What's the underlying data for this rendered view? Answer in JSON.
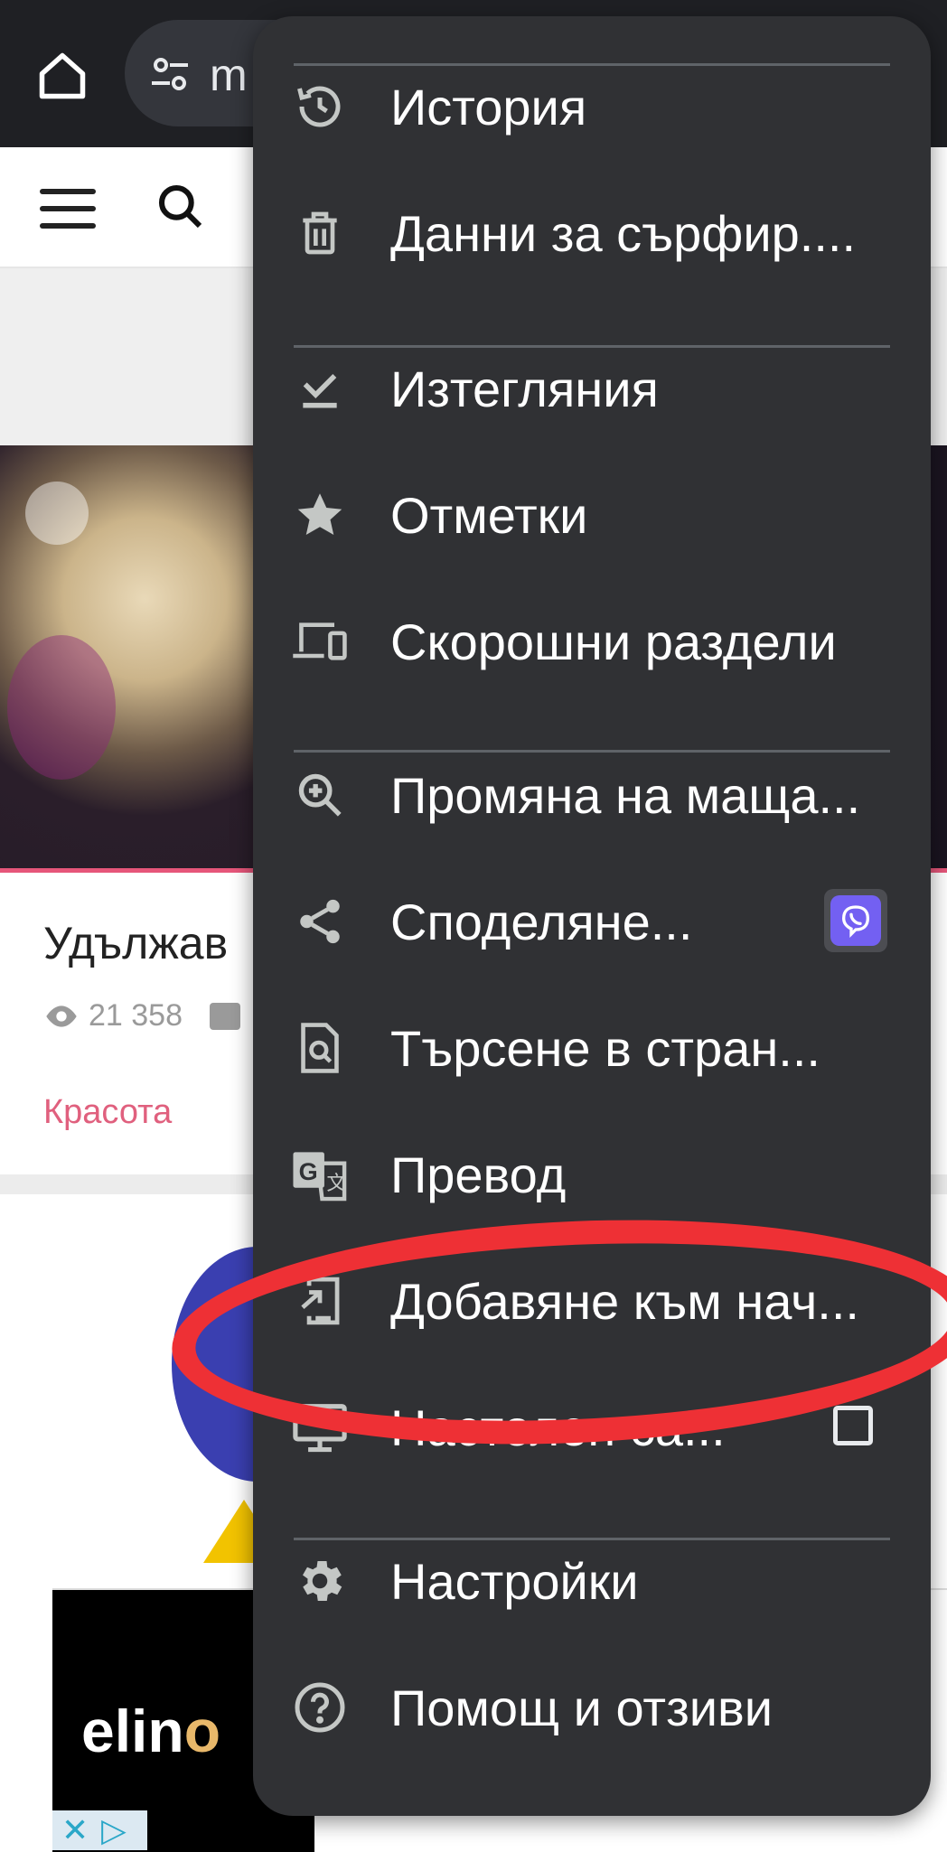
{
  "toolbar": {
    "url_partial": "m"
  },
  "page": {
    "article_title_partial": "Удължав",
    "views": "21 358",
    "category": "Красота",
    "ad_logo_partial": "elin",
    "ad_logo_letter": "o"
  },
  "menu": {
    "items": [
      {
        "label": "История",
        "icon": "history-icon"
      },
      {
        "label": "Данни за сърфир....",
        "icon": "delete-icon"
      },
      {
        "label": "Изтегляния",
        "icon": "download-done-icon"
      },
      {
        "label": "Отметки",
        "icon": "star-icon"
      },
      {
        "label": "Скорошни раздели",
        "icon": "devices-icon"
      },
      {
        "label": "Промяна на маща...",
        "icon": "zoom-in-icon"
      },
      {
        "label": "Споделяне...",
        "icon": "share-icon",
        "badge_icon": "viber-icon"
      },
      {
        "label": "Търсене в стран...",
        "icon": "find-in-page-icon"
      },
      {
        "label": "Превод",
        "icon": "translate-icon"
      },
      {
        "label": "Добавяне към нач...",
        "icon": "add-to-home-screen-icon"
      },
      {
        "label": "Настолен са...",
        "icon": "desktop-icon",
        "checkbox_checked": false
      },
      {
        "label": "Настройки",
        "icon": "settings-icon"
      },
      {
        "label": "Помощ и отзиви",
        "icon": "help-icon"
      }
    ]
  },
  "annotation": {
    "color": "#ee3035",
    "highlighted_item": "Добавяне към нач..."
  },
  "colors": {
    "menu_bg": "#303134",
    "toolbar_bg": "#1f2024",
    "accent_pink": "#e0607e"
  }
}
